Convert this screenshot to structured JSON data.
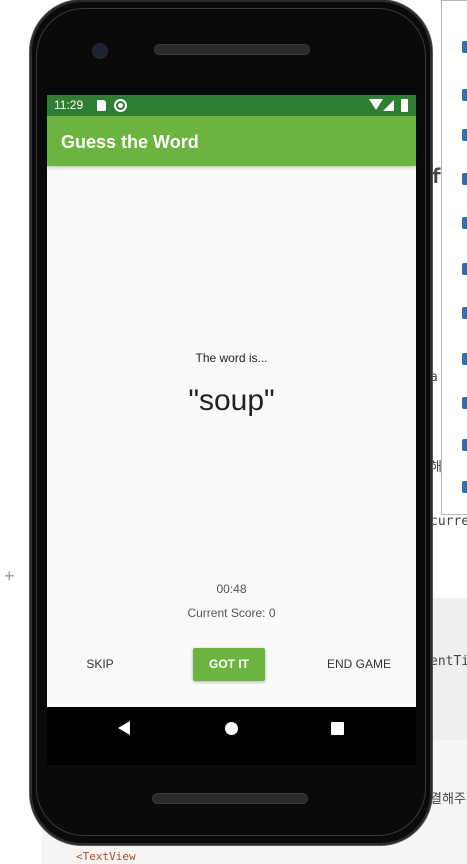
{
  "status_bar": {
    "time": "11:29"
  },
  "app_bar": {
    "title": "Guess the Word"
  },
  "game": {
    "word_intro": "The word is...",
    "word": "\"soup\"",
    "timer": "00:48",
    "score_label": "Current Score: 0"
  },
  "buttons": {
    "skip": "SKIP",
    "got_it": "GOT IT",
    "end_game": "END GAME"
  },
  "background_ide": {
    "frag_current": "curren",
    "frag_entity": "entTi",
    "frag_korean_1": "해",
    "frag_korean_2": "결해주",
    "frag_a": "a",
    "frag_f": "f",
    "frag_textview": "<TextView"
  },
  "colors": {
    "status_bar": "#2e7d32",
    "app_bar": "#6db33f",
    "button_accent": "#6db33f",
    "screen_background": "#fafafa"
  }
}
